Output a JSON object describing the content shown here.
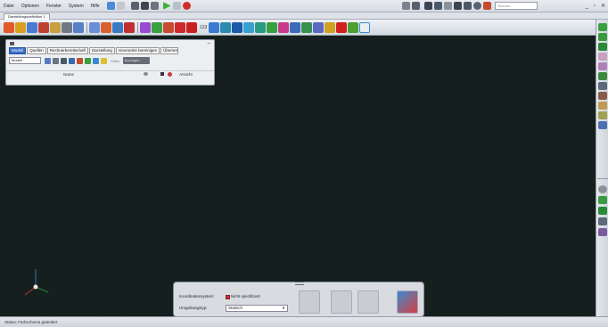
{
  "menu": {
    "items": [
      "Datei",
      "Optionen",
      "Fenster",
      "System",
      "Hilfe"
    ],
    "search_placeholder": "Suchen...",
    "win_controls": [
      "_",
      "▫",
      "✕"
    ]
  },
  "document_tab": "Darstellungsdefinition 1",
  "toolbar": {
    "counter_label": "123"
  },
  "panel": {
    "tabs": [
      "Modell",
      "Quellen",
      "Rechnerbereitschaft",
      "Darstellung",
      "Geometrie bereinigen",
      "Übersetzungen"
    ],
    "active_tab": 0,
    "filter_select": "Modell",
    "filter_hint": "Vollst.",
    "action_button": "Anzeigen",
    "columns": {
      "name": "Name",
      "visibility": "Ansicht"
    }
  },
  "setup": {
    "coord_label": "Koordinatensystem:",
    "coord_check_label": "Nicht spezifiziert",
    "env_label": "Umgebungstyp:",
    "env_value": "Statisch"
  },
  "status": {
    "text": "Status:  Farbschema geändert"
  },
  "colors": {
    "viewport": "#15201e",
    "accent_blue": "#3b6fc5",
    "green": "#3fae3a",
    "red": "#d22d2d"
  }
}
